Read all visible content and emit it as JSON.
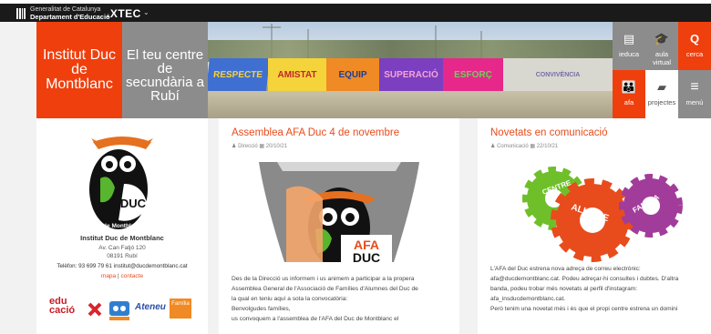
{
  "topbar": {
    "gen_line1": "Generalitat de Catalunya",
    "gen_line2": "Departament d'Educació",
    "xtec": ".XTEC",
    "chevron": "⌄"
  },
  "hero": {
    "institute": [
      "Institut Duc",
      "de",
      "Montblanc"
    ],
    "tagline": [
      "El teu centre de",
      "secundària a",
      "Rubí"
    ],
    "mural_words": [
      "RESPECTE",
      "AMISTAT",
      "EQUIP",
      "SUPERACIÓ",
      "ESFORÇ",
      "CONVIVÈNCIA"
    ],
    "tiles": [
      {
        "label": "ieduca",
        "icon": "▤",
        "bg": "#8c8c8c",
        "color": "#ffffff"
      },
      {
        "label": "aula virtual",
        "icon": "🎓",
        "bg": "#8c8c8c",
        "color": "#ffffff"
      },
      {
        "label": "cerca",
        "icon": "Q",
        "bg": "#ef3f0d",
        "color": "#ffffff"
      },
      {
        "label": "afa",
        "icon": "👪",
        "bg": "#ef3f0d",
        "color": "#ffffff"
      },
      {
        "label": "projectes",
        "icon": "▰",
        "bg": "#ffffff",
        "color": "#555555"
      },
      {
        "label": "menú",
        "icon": "≡",
        "bg": "#8c8c8c",
        "color": "#ffffff"
      }
    ]
  },
  "sidebar": {
    "logo_text_duc": "DUC",
    "logo_text_mont": "de Montblanc",
    "name": "Institut Duc de Montblanc",
    "address1": "Av. Can Fatjó 120",
    "address2": "08191 Rubí",
    "contact": "Telèfon: 93 699 79 61 institut@ducdemontblanc.cat",
    "link_map": "mapa",
    "link_sep": "|",
    "link_contact": "contacte",
    "partner_educacio": "edu cació",
    "partner_ateneu": "Ateneu",
    "partner_familia": "Família"
  },
  "post1": {
    "title": "Assemblea AFA Duc 4 de novembre",
    "author": "Direcció",
    "date": "20/10/21",
    "img_text_afa": "AFA",
    "img_text_duc": "DUC",
    "lines": [
      "Des de la Direcció us informem i us animem a participar a la propera",
      "Assemblea General de l'Associació de Famílies d'Alumnes del Duc de",
      "la qual en teniu aquí a sota la convocatòria:",
      "Benvolgudes famílies,",
      "us convoquem a l'assemblea de l'AFA del Duc de Montblanc el"
    ]
  },
  "post2": {
    "title": "Novetats en comunicació",
    "author": "Comunicació",
    "date": "22/10/21",
    "gear_words": [
      "CENTRE",
      "ALUMNE",
      "FAMÍLIA"
    ],
    "lines": [
      "L'AFA del Duc estrena nova adreça de correu electrònic:",
      "afa@ducdemontblanc.cat. Podeu adreçar-hi consultes i dubtes. D'altra",
      "banda, podeu trobar més novetats al perfil d'instagram:",
      "afa_insducdemontblanc.cat.",
      "Però tenim una novetat més i és que el propi centre estrena un domini"
    ]
  },
  "colors": {
    "accent": "#ef3f0d",
    "gray": "#8c8c8c",
    "link": "#e84c1c"
  }
}
